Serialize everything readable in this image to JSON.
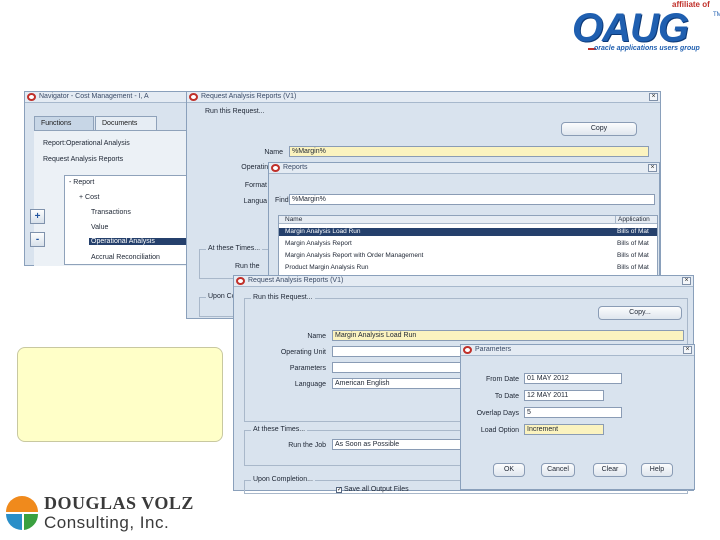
{
  "oaug": {
    "affiliate": "affiliate of",
    "word": "OAUG",
    "tm": "TM",
    "tagline": "oracle applications users group"
  },
  "navigator": {
    "title": "Navigator - Cost Management - I, A",
    "tabs": [
      "Functions",
      "Documents"
    ],
    "path": [
      "Report:Operational Analysis",
      "Request Analysis Reports"
    ],
    "tree": [
      "- Report",
      "+ Cost",
      "Transactions",
      "Value",
      "Operational Analysis",
      "Accrual Reconciliation"
    ],
    "side_buttons": [
      "+",
      "-"
    ]
  },
  "request_back": {
    "title": "Request Analysis Reports (V1)",
    "run_this_request": "Run this Request...",
    "copy_button": "Copy",
    "name_label": "Name",
    "name_value": "%Margin%",
    "operating_unit_label": "Operating U",
    "format_label": "Format",
    "lang_label": "Langua",
    "at_these_times": "At these Times...",
    "run_the": "Run the",
    "upon_com": "Upon Co"
  },
  "reports_lov": {
    "title": "Reports",
    "find_label": "Find",
    "find_value": "%Margin%",
    "columns": [
      "Name",
      "Application"
    ],
    "rows": [
      {
        "name": "Margin Analysis Load Run",
        "app": "Bills of Mat"
      },
      {
        "name": "Margin Analysis Report",
        "app": "Bills of Mat"
      },
      {
        "name": "Margin Analysis Report with Order Management",
        "app": "Bills of Mat"
      },
      {
        "name": "Product Margin Analysis Run",
        "app": "Bills of Mat"
      }
    ]
  },
  "request_front": {
    "title": "Request Analysis Reports (V1)",
    "run_this_request": "Run this Request...",
    "copy_button": "Copy...",
    "name_label": "Name",
    "name_value": "Margin Analysis Load Run",
    "operating_unit_label": "Operating Unit",
    "parameters_label": "Parameters",
    "language_label": "Language",
    "language_value": "American English",
    "at_these_times": "At these Times...",
    "run_the_job_label": "Run the Job",
    "run_the_job_value": "As Soon as Possible",
    "upon_completion": "Upon Completion...",
    "save_output": "Save all Output Files"
  },
  "parameters": {
    "title": "Parameters",
    "from_date_label": "From Date",
    "from_date_value": "01 MAY 2012",
    "to_date_label": "To Date",
    "to_date_value": "12 MAY 2011",
    "overlap_label": "Overlap Days",
    "overlap_value": "5",
    "load_option_label": "Load Option",
    "load_option_value": "Increment",
    "buttons": [
      "OK",
      "Cancel",
      "Clear",
      "Help"
    ]
  },
  "douglas_volz": {
    "name": "DOUGLAS VOLZ",
    "sub": "Consulting, Inc."
  }
}
